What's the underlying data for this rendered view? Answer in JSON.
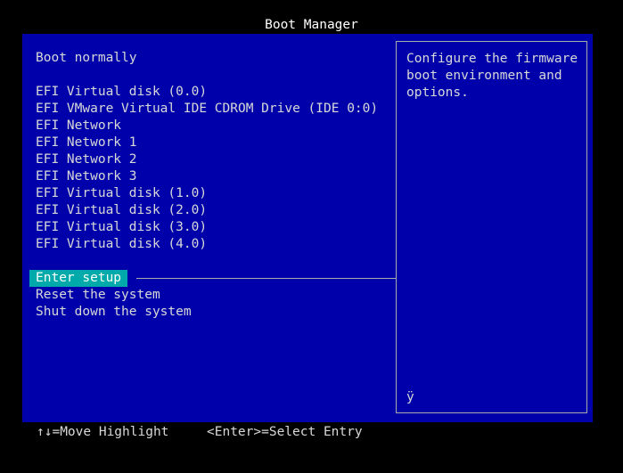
{
  "title": "Boot Manager",
  "menu": {
    "items": [
      {
        "label": "Boot normally"
      },
      {
        "label": "EFI Virtual disk (0.0)"
      },
      {
        "label": "EFI VMware Virtual IDE CDROM Drive (IDE 0:0)"
      },
      {
        "label": "EFI Network"
      },
      {
        "label": "EFI Network 1"
      },
      {
        "label": "EFI Network 2"
      },
      {
        "label": "EFI Network 3"
      },
      {
        "label": "EFI Virtual disk (1.0)"
      },
      {
        "label": "EFI Virtual disk (2.0)"
      },
      {
        "label": "EFI Virtual disk (3.0)"
      },
      {
        "label": "EFI Virtual disk (4.0)"
      },
      {
        "label": "Enter setup",
        "selected": true
      },
      {
        "label": "Reset the system"
      },
      {
        "label": "Shut down the system"
      }
    ]
  },
  "help": {
    "text": "Configure the firmware boot environment and options.",
    "glyph": "ÿ"
  },
  "footer": {
    "move_hint": "↑↓=Move Highlight",
    "select_hint": "<Enter>=Select Entry"
  },
  "colors": {
    "background": "#000000",
    "panel": "#0000aa",
    "highlight": "#00aaaa",
    "text": "#d8d8d8",
    "title": "#ffffff"
  }
}
